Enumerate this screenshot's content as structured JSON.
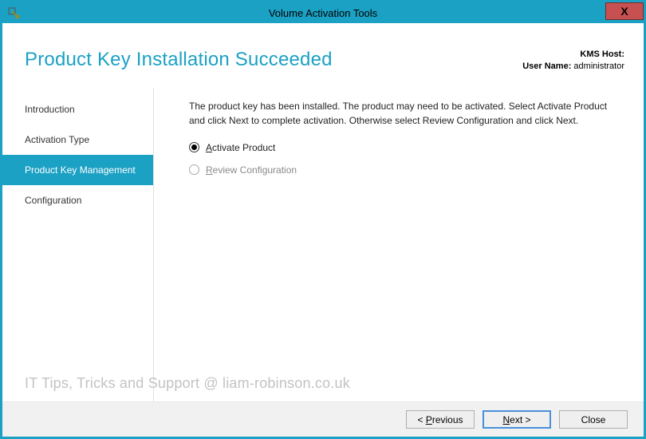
{
  "window": {
    "title": "Volume Activation Tools"
  },
  "header": {
    "page_title": "Product Key Installation Succeeded",
    "kms_host_label": "KMS Host:",
    "kms_host_value": "",
    "user_name_label": "User Name:",
    "user_name_value": "administrator"
  },
  "sidebar": {
    "items": [
      {
        "label": "Introduction",
        "active": false
      },
      {
        "label": "Activation Type",
        "active": false
      },
      {
        "label": "Product Key Management",
        "active": true
      },
      {
        "label": "Configuration",
        "active": false
      }
    ]
  },
  "main": {
    "instruction": "The product key has been installed. The product may need to be activated. Select Activate Product and click Next to complete activation. Otherwise select Review Configuration and click Next.",
    "options": [
      {
        "label_pre": "",
        "mnemonic": "A",
        "label_post": "ctivate Product",
        "selected": true
      },
      {
        "label_pre": "",
        "mnemonic": "R",
        "label_post": "eview Configuration",
        "selected": false
      }
    ]
  },
  "watermark": "IT Tips, Tricks and Support @ liam-robinson.co.uk",
  "footer": {
    "previous_pre": "< ",
    "previous_mn": "P",
    "previous_post": "revious",
    "next_pre": "",
    "next_mn": "N",
    "next_post": "ext >",
    "close": "Close"
  }
}
